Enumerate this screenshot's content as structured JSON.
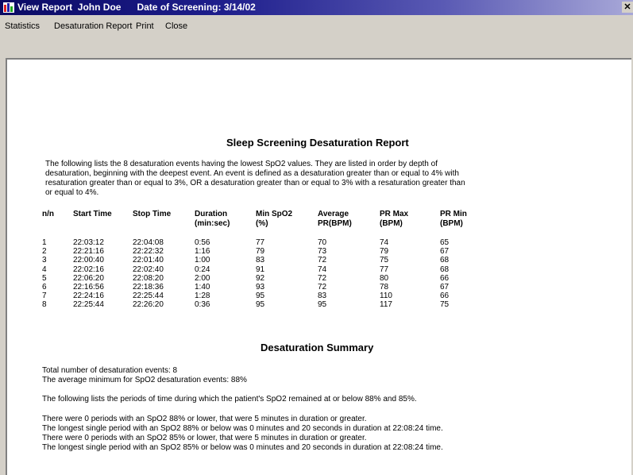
{
  "window": {
    "title": "View Report  John Doe      Date of Screening: 3/14/02",
    "close_label": "✕"
  },
  "menu": [
    "Statistics",
    "Desaturation Report",
    "Print",
    "Close"
  ],
  "report": {
    "title": "Sleep Screening Desaturation Report",
    "intro_lines": [
      "The following lists the 8 desaturation events having the lowest SpO2 values. They are listed in order by depth of",
      "desaturation, beginning with the deepest event. An event is defined as a desaturation greater than or equal to 4% with",
      " resaturation greater than or equal to 3%, OR a desaturation greater than or equal to 3% with a resaturation greater than",
      "or equal to 4%."
    ],
    "columns": [
      [
        "n/n",
        ""
      ],
      [
        "Start Time",
        ""
      ],
      [
        "Stop Time",
        ""
      ],
      [
        "Duration",
        "(min:sec)"
      ],
      [
        "Min SpO2",
        "(%)"
      ],
      [
        "Average",
        "PR(BPM)"
      ],
      [
        "PR Max",
        "(BPM)"
      ],
      [
        "PR Min",
        "(BPM)"
      ]
    ],
    "rows": [
      [
        "1",
        "22:03:12",
        "22:04:08",
        "0:56",
        "77",
        "70",
        "74",
        "65"
      ],
      [
        "2",
        "22:21:16",
        "22:22:32",
        "1:16",
        "79",
        "73",
        "79",
        "67"
      ],
      [
        "3",
        "22:00:40",
        "22:01:40",
        "1:00",
        "83",
        "72",
        "75",
        "68"
      ],
      [
        "4",
        "22:02:16",
        "22:02:40",
        "0:24",
        "91",
        "74",
        "77",
        "68"
      ],
      [
        "5",
        "22:06:20",
        "22:08:20",
        "2:00",
        "92",
        "72",
        "80",
        "66"
      ],
      [
        "6",
        "22:16:56",
        "22:18:36",
        "1:40",
        "93",
        "72",
        "78",
        "67"
      ],
      [
        "7",
        "22:24:16",
        "22:25:44",
        "1:28",
        "95",
        "83",
        "110",
        "66"
      ],
      [
        "8",
        "22:25:44",
        "22:26:20",
        "0:36",
        "95",
        "95",
        "117",
        "75"
      ]
    ]
  },
  "summary": {
    "title": "Desaturation Summary",
    "total_events": "Total number of desaturation events: 8",
    "average_min": "The average minimum for SpO2 desaturation events: 88%",
    "periods_intro": " The following lists the periods of time during which the patient's SpO2 remained at or below 88% and 85%.",
    "lines": [
      "There were 0 periods with an SpO2 88% or lower, that were 5 minutes in duration or greater.",
      "The longest single period with an SpO2 88% or below was 0 minutes and 20 seconds in duration at 22:08:24 time.",
      "There were 0 periods with an SpO2 85% or lower, that were 5 minutes in duration or greater.",
      "The longest single period with an SpO2 85% or below was 0 minutes and 20 seconds in duration at 22:08:24 time."
    ]
  }
}
